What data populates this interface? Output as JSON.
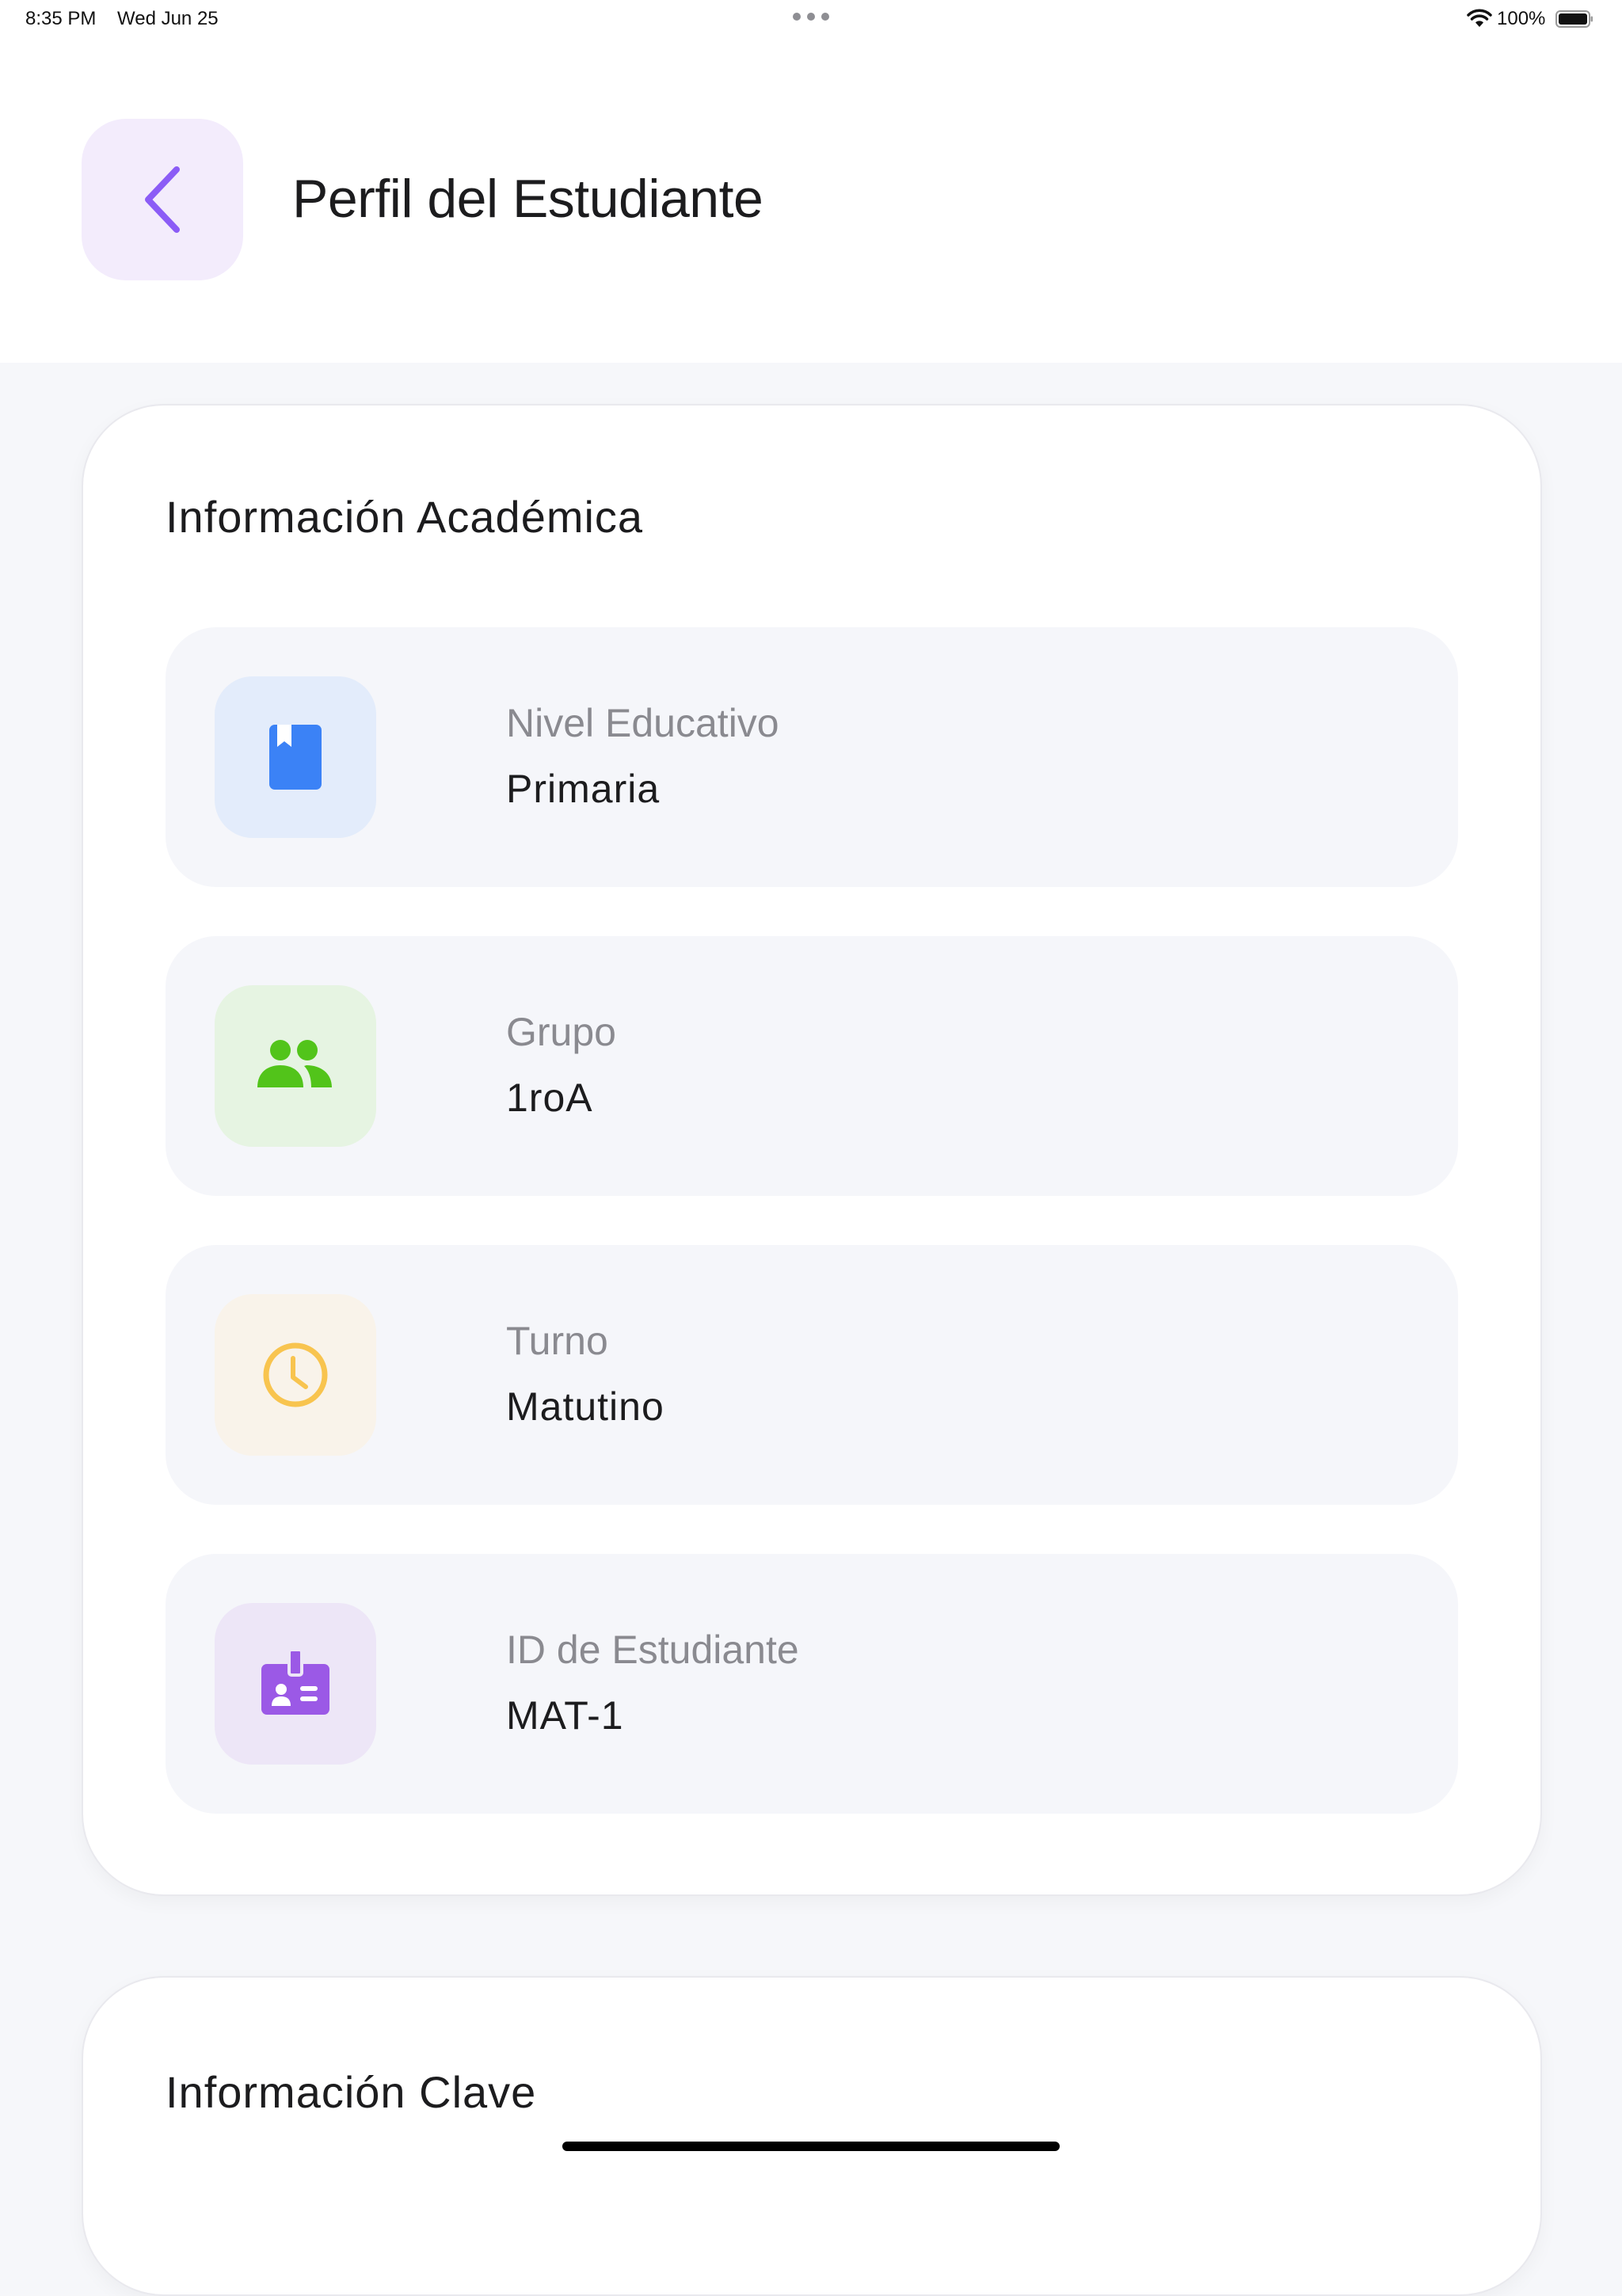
{
  "status_bar": {
    "time": "8:35 PM",
    "date": "Wed Jun 25",
    "battery": "100%"
  },
  "header": {
    "back_icon": "chevron-left-icon",
    "title": "Perfil del Estudiante"
  },
  "academic_card": {
    "title": "Información Académica",
    "rows": [
      {
        "icon": "book-icon",
        "label": "Nivel Educativo",
        "value": "Primaria",
        "icon_color": "#3b82f6",
        "tile_color": "#e3ecfb"
      },
      {
        "icon": "group-icon",
        "label": "Grupo",
        "value": "1roA",
        "icon_color": "#52c41a",
        "tile_color": "#e6f4e2"
      },
      {
        "icon": "clock-icon",
        "label": "Turno",
        "value": "Matutino",
        "icon_color": "#f8c44f",
        "tile_color": "#f9f3ea"
      },
      {
        "icon": "id-badge-icon",
        "label": "ID de Estudiante",
        "value": "MAT-1",
        "icon_color": "#9b59e6",
        "tile_color": "#ede6f7"
      }
    ]
  },
  "key_card": {
    "title": "Información Clave"
  },
  "colors": {
    "accent": "#8b5cf6",
    "background": "#f6f7fa",
    "card": "#ffffff"
  }
}
